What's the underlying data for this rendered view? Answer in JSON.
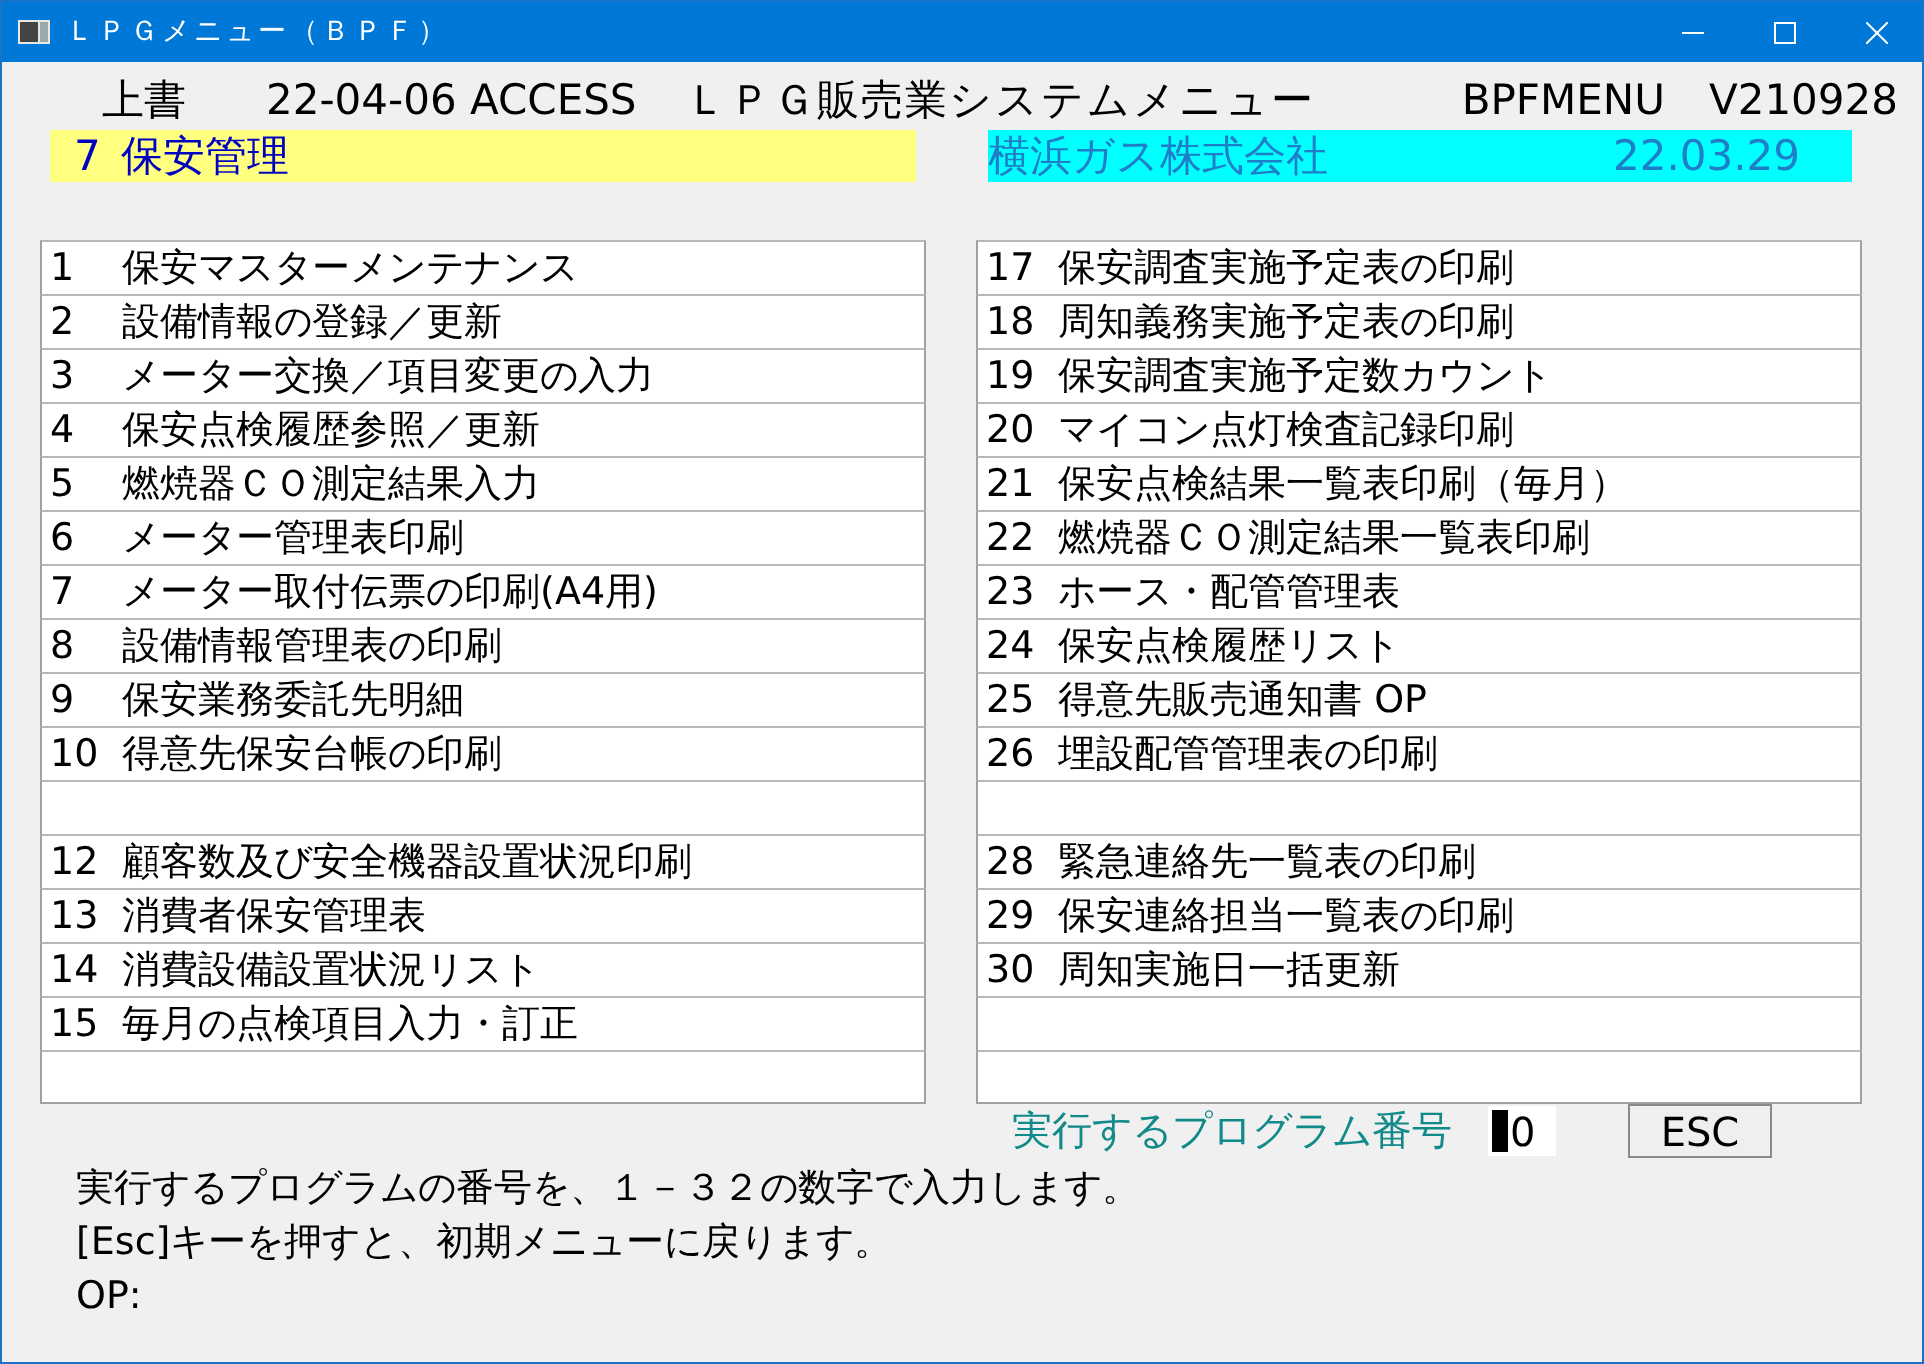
{
  "window": {
    "title": "ＬＰＧメニュー（ＢＰＦ）"
  },
  "header": {
    "mode": "上書",
    "date": "22-04-06 ACCESS",
    "system_title": "ＬＰＧ販売業システムメニュー",
    "program_id": "BPFMENU",
    "version": "V210928"
  },
  "category": {
    "number": "7",
    "name": "保安管理"
  },
  "company": {
    "name": "横浜ガス株式会社",
    "date": "22.03.29"
  },
  "menu_left": [
    {
      "kind": "entry",
      "number": "1",
      "label": "保安マスターメンテナンス"
    },
    {
      "kind": "entry",
      "number": "2",
      "label": "設備情報の登録／更新"
    },
    {
      "kind": "entry",
      "number": "3",
      "label": "メーター交換／項目変更の入力"
    },
    {
      "kind": "entry",
      "number": "4",
      "label": "保安点検履歴参照／更新"
    },
    {
      "kind": "entry",
      "number": "5",
      "label": "燃焼器ＣＯ測定結果入力"
    },
    {
      "kind": "entry",
      "number": "6",
      "label": "メーター管理表印刷"
    },
    {
      "kind": "entry",
      "number": "7",
      "label": "メーター取付伝票の印刷(A4用)"
    },
    {
      "kind": "entry",
      "number": "8",
      "label": "設備情報管理表の印刷"
    },
    {
      "kind": "entry",
      "number": "9",
      "label": "保安業務委託先明細"
    },
    {
      "kind": "entry",
      "number": "10",
      "label": "得意先保安台帳の印刷"
    },
    {
      "kind": "blank"
    },
    {
      "kind": "entry",
      "number": "12",
      "label": "顧客数及び安全機器設置状況印刷"
    },
    {
      "kind": "entry",
      "number": "13",
      "label": "消費者保安管理表"
    },
    {
      "kind": "entry",
      "number": "14",
      "label": "消費設備設置状況リスト"
    },
    {
      "kind": "entry",
      "number": "15",
      "label": "毎月の点検項目入力・訂正"
    },
    {
      "kind": "blank"
    }
  ],
  "menu_right": [
    {
      "kind": "entry",
      "number": "17",
      "label": "保安調査実施予定表の印刷"
    },
    {
      "kind": "entry",
      "number": "18",
      "label": "周知義務実施予定表の印刷"
    },
    {
      "kind": "entry",
      "number": "19",
      "label": "保安調査実施予定数カウント"
    },
    {
      "kind": "entry",
      "number": "20",
      "label": "マイコン点灯検査記録印刷"
    },
    {
      "kind": "entry",
      "number": "21",
      "label": "保安点検結果一覧表印刷（毎月）"
    },
    {
      "kind": "entry",
      "number": "22",
      "label": "燃焼器ＣＯ測定結果一覧表印刷"
    },
    {
      "kind": "entry",
      "number": "23",
      "label": "ホース・配管管理表"
    },
    {
      "kind": "entry",
      "number": "24",
      "label": "保安点検履歴リスト"
    },
    {
      "kind": "entry",
      "number": "25",
      "label": "得意先販売通知書 OP"
    },
    {
      "kind": "entry",
      "number": "26",
      "label": "埋設配管管理表の印刷"
    },
    {
      "kind": "blank"
    },
    {
      "kind": "entry",
      "number": "28",
      "label": "緊急連絡先一覧表の印刷"
    },
    {
      "kind": "entry",
      "number": "29",
      "label": "保安連絡担当一覧表の印刷"
    },
    {
      "kind": "entry",
      "number": "30",
      "label": "周知実施日一括更新"
    },
    {
      "kind": "blank"
    },
    {
      "kind": "blank"
    }
  ],
  "program_input": {
    "label": "実行するプログラム番号",
    "value": "0"
  },
  "buttons": [
    "ESC"
  ],
  "messages": [
    "実行するプログラムの番号を、１－３２の数字で入力します。",
    "[Esc]キーを押すと、初期メニューに戻ります。",
    "OP:"
  ]
}
